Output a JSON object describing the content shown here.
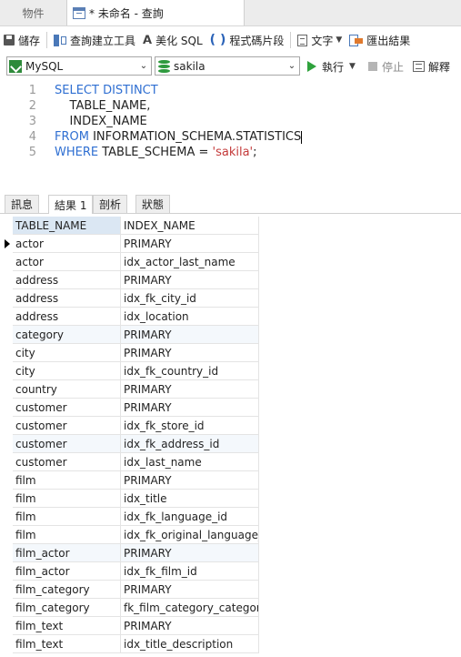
{
  "window_tabs": {
    "objects_label": "物件",
    "query_tab_label": "* 未命名 - 查詢"
  },
  "toolbar": {
    "save_label": "儲存",
    "query_builder_label": "查詢建立工具",
    "beautify_label": "美化 SQL",
    "snippet_label": "程式碼片段",
    "text_label": "文字",
    "export_label": "匯出結果"
  },
  "connection": {
    "connection_value": "MySQL",
    "database_value": "sakila",
    "run_label": "執行",
    "stop_label": "停止",
    "explain_label": "解釋"
  },
  "editor": {
    "line_numbers": [
      "1",
      "2",
      "3",
      "4",
      "5"
    ],
    "lines": [
      [
        {
          "t": "SELECT DISTINCT",
          "k": "kw"
        }
      ],
      [
        {
          "t": "    TABLE_NAME,",
          "k": "plain"
        }
      ],
      [
        {
          "t": "    INDEX_NAME",
          "k": "plain"
        }
      ],
      [
        {
          "t": "FROM",
          "k": "kw"
        },
        {
          "t": " INFORMATION_SCHEMA.STATISTICS",
          "k": "plain"
        }
      ],
      [
        {
          "t": "WHERE",
          "k": "kw"
        },
        {
          "t": " TABLE_SCHEMA = ",
          "k": "plain"
        },
        {
          "t": "'sakila'",
          "k": "str"
        },
        {
          "t": ";",
          "k": "plain"
        }
      ]
    ]
  },
  "result_tabs": [
    "訊息",
    "結果 1",
    "剖析",
    "狀態"
  ],
  "results": {
    "columns": [
      "TABLE_NAME",
      "INDEX_NAME"
    ],
    "rows": [
      [
        "actor",
        "PRIMARY"
      ],
      [
        "actor",
        "idx_actor_last_name"
      ],
      [
        "address",
        "PRIMARY"
      ],
      [
        "address",
        "idx_fk_city_id"
      ],
      [
        "address",
        "idx_location"
      ],
      [
        "category",
        "PRIMARY"
      ],
      [
        "city",
        "PRIMARY"
      ],
      [
        "city",
        "idx_fk_country_id"
      ],
      [
        "country",
        "PRIMARY"
      ],
      [
        "customer",
        "PRIMARY"
      ],
      [
        "customer",
        "idx_fk_store_id"
      ],
      [
        "customer",
        "idx_fk_address_id"
      ],
      [
        "customer",
        "idx_last_name"
      ],
      [
        "film",
        "PRIMARY"
      ],
      [
        "film",
        "idx_title"
      ],
      [
        "film",
        "idx_fk_language_id"
      ],
      [
        "film",
        "idx_fk_original_language_id"
      ],
      [
        "film_actor",
        "PRIMARY"
      ],
      [
        "film_actor",
        "idx_fk_film_id"
      ],
      [
        "film_category",
        "PRIMARY"
      ],
      [
        "film_category",
        "fk_film_category_category"
      ],
      [
        "film_text",
        "PRIMARY"
      ],
      [
        "film_text",
        "idx_title_description"
      ]
    ]
  }
}
